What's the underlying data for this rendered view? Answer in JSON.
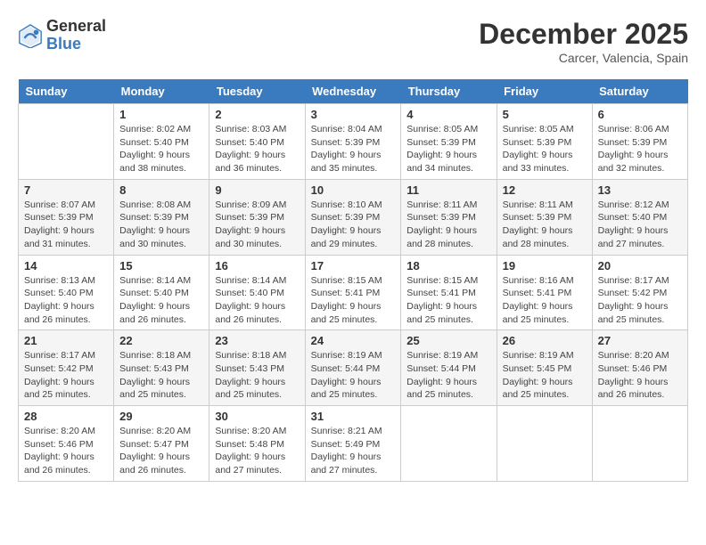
{
  "header": {
    "logo_general": "General",
    "logo_blue": "Blue",
    "month_title": "December 2025",
    "location": "Carcer, Valencia, Spain"
  },
  "weekdays": [
    "Sunday",
    "Monday",
    "Tuesday",
    "Wednesday",
    "Thursday",
    "Friday",
    "Saturday"
  ],
  "weeks": [
    [
      {
        "day": "",
        "sunrise": "",
        "sunset": "",
        "daylight": ""
      },
      {
        "day": "1",
        "sunrise": "Sunrise: 8:02 AM",
        "sunset": "Sunset: 5:40 PM",
        "daylight": "Daylight: 9 hours and 38 minutes."
      },
      {
        "day": "2",
        "sunrise": "Sunrise: 8:03 AM",
        "sunset": "Sunset: 5:40 PM",
        "daylight": "Daylight: 9 hours and 36 minutes."
      },
      {
        "day": "3",
        "sunrise": "Sunrise: 8:04 AM",
        "sunset": "Sunset: 5:39 PM",
        "daylight": "Daylight: 9 hours and 35 minutes."
      },
      {
        "day": "4",
        "sunrise": "Sunrise: 8:05 AM",
        "sunset": "Sunset: 5:39 PM",
        "daylight": "Daylight: 9 hours and 34 minutes."
      },
      {
        "day": "5",
        "sunrise": "Sunrise: 8:05 AM",
        "sunset": "Sunset: 5:39 PM",
        "daylight": "Daylight: 9 hours and 33 minutes."
      },
      {
        "day": "6",
        "sunrise": "Sunrise: 8:06 AM",
        "sunset": "Sunset: 5:39 PM",
        "daylight": "Daylight: 9 hours and 32 minutes."
      }
    ],
    [
      {
        "day": "7",
        "sunrise": "Sunrise: 8:07 AM",
        "sunset": "Sunset: 5:39 PM",
        "daylight": "Daylight: 9 hours and 31 minutes."
      },
      {
        "day": "8",
        "sunrise": "Sunrise: 8:08 AM",
        "sunset": "Sunset: 5:39 PM",
        "daylight": "Daylight: 9 hours and 30 minutes."
      },
      {
        "day": "9",
        "sunrise": "Sunrise: 8:09 AM",
        "sunset": "Sunset: 5:39 PM",
        "daylight": "Daylight: 9 hours and 30 minutes."
      },
      {
        "day": "10",
        "sunrise": "Sunrise: 8:10 AM",
        "sunset": "Sunset: 5:39 PM",
        "daylight": "Daylight: 9 hours and 29 minutes."
      },
      {
        "day": "11",
        "sunrise": "Sunrise: 8:11 AM",
        "sunset": "Sunset: 5:39 PM",
        "daylight": "Daylight: 9 hours and 28 minutes."
      },
      {
        "day": "12",
        "sunrise": "Sunrise: 8:11 AM",
        "sunset": "Sunset: 5:39 PM",
        "daylight": "Daylight: 9 hours and 28 minutes."
      },
      {
        "day": "13",
        "sunrise": "Sunrise: 8:12 AM",
        "sunset": "Sunset: 5:40 PM",
        "daylight": "Daylight: 9 hours and 27 minutes."
      }
    ],
    [
      {
        "day": "14",
        "sunrise": "Sunrise: 8:13 AM",
        "sunset": "Sunset: 5:40 PM",
        "daylight": "Daylight: 9 hours and 26 minutes."
      },
      {
        "day": "15",
        "sunrise": "Sunrise: 8:14 AM",
        "sunset": "Sunset: 5:40 PM",
        "daylight": "Daylight: 9 hours and 26 minutes."
      },
      {
        "day": "16",
        "sunrise": "Sunrise: 8:14 AM",
        "sunset": "Sunset: 5:40 PM",
        "daylight": "Daylight: 9 hours and 26 minutes."
      },
      {
        "day": "17",
        "sunrise": "Sunrise: 8:15 AM",
        "sunset": "Sunset: 5:41 PM",
        "daylight": "Daylight: 9 hours and 25 minutes."
      },
      {
        "day": "18",
        "sunrise": "Sunrise: 8:15 AM",
        "sunset": "Sunset: 5:41 PM",
        "daylight": "Daylight: 9 hours and 25 minutes."
      },
      {
        "day": "19",
        "sunrise": "Sunrise: 8:16 AM",
        "sunset": "Sunset: 5:41 PM",
        "daylight": "Daylight: 9 hours and 25 minutes."
      },
      {
        "day": "20",
        "sunrise": "Sunrise: 8:17 AM",
        "sunset": "Sunset: 5:42 PM",
        "daylight": "Daylight: 9 hours and 25 minutes."
      }
    ],
    [
      {
        "day": "21",
        "sunrise": "Sunrise: 8:17 AM",
        "sunset": "Sunset: 5:42 PM",
        "daylight": "Daylight: 9 hours and 25 minutes."
      },
      {
        "day": "22",
        "sunrise": "Sunrise: 8:18 AM",
        "sunset": "Sunset: 5:43 PM",
        "daylight": "Daylight: 9 hours and 25 minutes."
      },
      {
        "day": "23",
        "sunrise": "Sunrise: 8:18 AM",
        "sunset": "Sunset: 5:43 PM",
        "daylight": "Daylight: 9 hours and 25 minutes."
      },
      {
        "day": "24",
        "sunrise": "Sunrise: 8:19 AM",
        "sunset": "Sunset: 5:44 PM",
        "daylight": "Daylight: 9 hours and 25 minutes."
      },
      {
        "day": "25",
        "sunrise": "Sunrise: 8:19 AM",
        "sunset": "Sunset: 5:44 PM",
        "daylight": "Daylight: 9 hours and 25 minutes."
      },
      {
        "day": "26",
        "sunrise": "Sunrise: 8:19 AM",
        "sunset": "Sunset: 5:45 PM",
        "daylight": "Daylight: 9 hours and 25 minutes."
      },
      {
        "day": "27",
        "sunrise": "Sunrise: 8:20 AM",
        "sunset": "Sunset: 5:46 PM",
        "daylight": "Daylight: 9 hours and 26 minutes."
      }
    ],
    [
      {
        "day": "28",
        "sunrise": "Sunrise: 8:20 AM",
        "sunset": "Sunset: 5:46 PM",
        "daylight": "Daylight: 9 hours and 26 minutes."
      },
      {
        "day": "29",
        "sunrise": "Sunrise: 8:20 AM",
        "sunset": "Sunset: 5:47 PM",
        "daylight": "Daylight: 9 hours and 26 minutes."
      },
      {
        "day": "30",
        "sunrise": "Sunrise: 8:20 AM",
        "sunset": "Sunset: 5:48 PM",
        "daylight": "Daylight: 9 hours and 27 minutes."
      },
      {
        "day": "31",
        "sunrise": "Sunrise: 8:21 AM",
        "sunset": "Sunset: 5:49 PM",
        "daylight": "Daylight: 9 hours and 27 minutes."
      },
      {
        "day": "",
        "sunrise": "",
        "sunset": "",
        "daylight": ""
      },
      {
        "day": "",
        "sunrise": "",
        "sunset": "",
        "daylight": ""
      },
      {
        "day": "",
        "sunrise": "",
        "sunset": "",
        "daylight": ""
      }
    ]
  ]
}
